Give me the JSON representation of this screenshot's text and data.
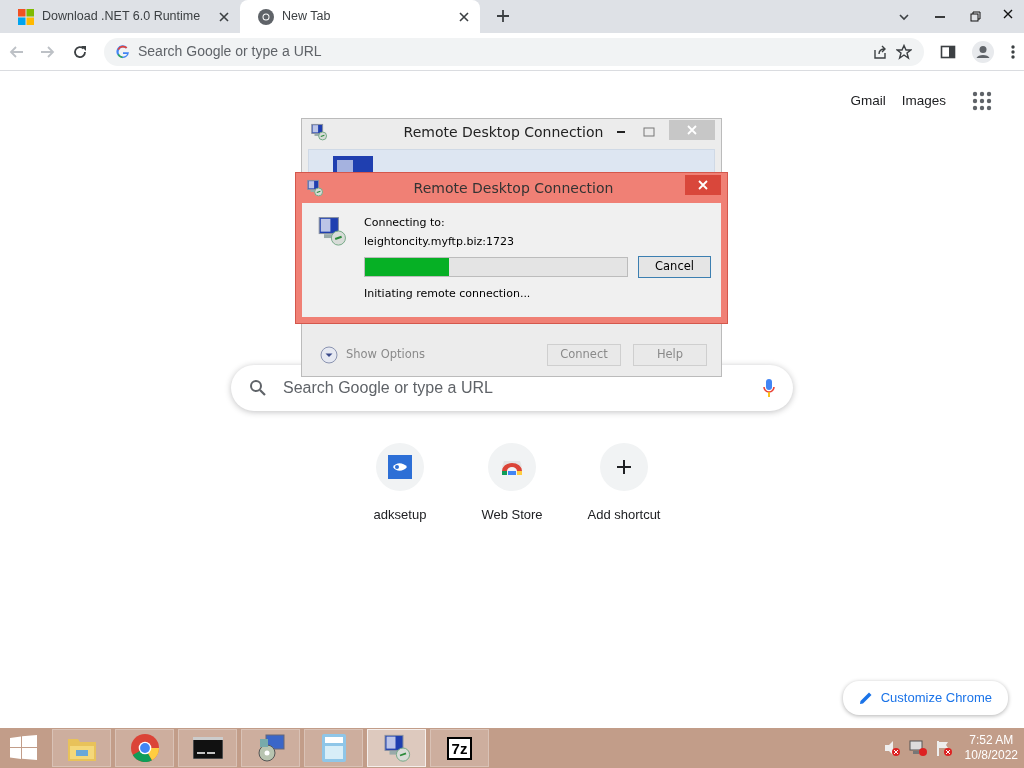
{
  "browser": {
    "tabs": [
      {
        "title": "Download .NET 6.0 Runtime",
        "kind": "windows",
        "selected": false
      },
      {
        "title": "New Tab",
        "kind": "chrome",
        "selected": true
      }
    ],
    "omnibox": {
      "placeholder": "Search Google or type a URL"
    }
  },
  "page": {
    "top_links": [
      "Gmail",
      "Images"
    ],
    "search": {
      "placeholder": "Search Google or type a URL"
    },
    "shortcuts": [
      {
        "label": "adksetup",
        "kind": "site"
      },
      {
        "label": "Web Store",
        "kind": "store"
      },
      {
        "label": "Add shortcut",
        "kind": "add"
      }
    ],
    "customize_button": "Customize Chrome"
  },
  "back_window": {
    "title": "Remote Desktop Connection",
    "show_options": "Show Options",
    "buttons": [
      "Connect",
      "Help"
    ]
  },
  "dialog": {
    "title": "Remote Desktop Connection",
    "connecting_label": "Connecting to:",
    "host": "leightoncity.myftp.biz:1723",
    "progress": {
      "level": 0.32
    },
    "status": "Initiating remote connection...",
    "cancel_button": "Cancel"
  },
  "taskbar": {
    "apps": [
      {
        "kind": "explorer",
        "selected": false
      },
      {
        "kind": "chrome",
        "selected": false
      },
      {
        "kind": "cmd",
        "selected": false
      },
      {
        "kind": "installer",
        "selected": false
      },
      {
        "kind": "calculator",
        "selected": false
      },
      {
        "kind": "rdc",
        "selected": true
      },
      {
        "kind": "sevenzip",
        "label": "7z",
        "selected": false
      }
    ],
    "clock": {
      "time": "7:52 AM",
      "date": "10/8/2022"
    }
  }
}
